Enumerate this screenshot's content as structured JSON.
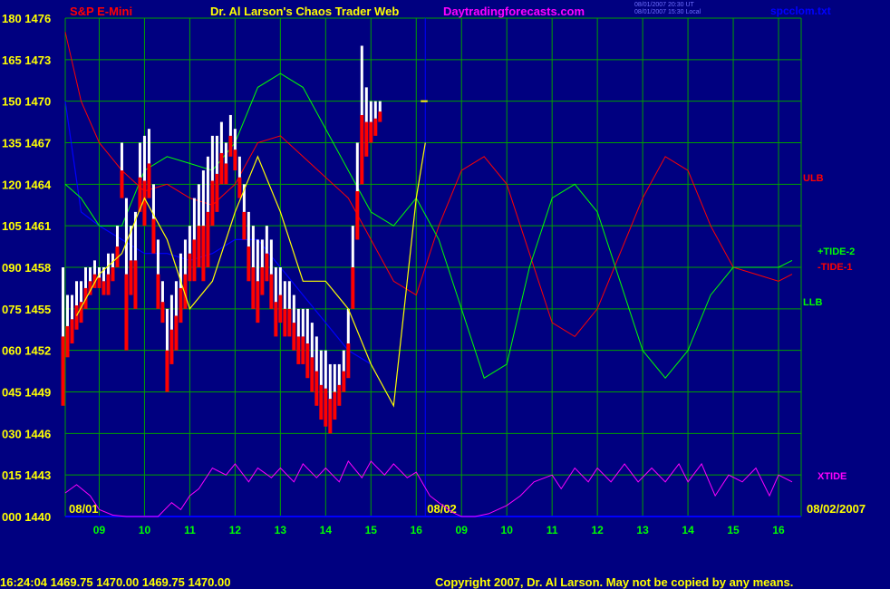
{
  "header": {
    "symbol": "S&P E-Mini",
    "title": "Dr. Al Larson's Chaos Trader Web",
    "site": "Daytradingforecasts.com",
    "time_line1": "08/01/2007 20:30 UT",
    "time_line2": "08/01/2007 15:30 Local",
    "filename": "spcclom.txt"
  },
  "footer": {
    "quote": "16:24:04  1469.75 1470.00 1469.75 1470.00",
    "copyright": "Copyright 2007, Dr. Al Larson. May not be copied by any means."
  },
  "colors": {
    "background": "#000080",
    "grid": "#00a000",
    "price_low": "#ff0000",
    "price_high": "#ffffff",
    "ulb": "#ff0000",
    "llb": "#00ff00",
    "xtide": "#ff00ff",
    "date_marker": "#0000ff"
  },
  "chart_data": {
    "type": "line",
    "title": "S&P E-Mini",
    "left_axis_ticks": [
      "180 1476",
      "165 1473",
      "150 1470",
      "135 1467",
      "120 1464",
      "105 1461",
      "090 1458",
      "075 1455",
      "060 1452",
      "045 1449",
      "030 1446",
      "015 1443",
      "000 1440"
    ],
    "ylim_price": [
      1440,
      1476
    ],
    "ylim_index": [
      0,
      180
    ],
    "x_ticks_day1": [
      "09",
      "10",
      "11",
      "12",
      "13",
      "14",
      "15",
      "16"
    ],
    "x_ticks_day2": [
      "09",
      "10",
      "11",
      "12",
      "13",
      "14",
      "15",
      "16"
    ],
    "date_labels": [
      "08/01",
      "08/02",
      "08/02/2007"
    ],
    "series_labels": [
      "ULB",
      "+TIDE-2",
      "-TIDE-1",
      "LLB",
      "XTIDE"
    ],
    "xlim_hours": [
      8.25,
      24.5
    ],
    "price_bars": {
      "x_hours": [
        8.2,
        8.3,
        8.4,
        8.5,
        8.6,
        8.7,
        8.8,
        8.9,
        9.0,
        9.1,
        9.2,
        9.3,
        9.4,
        9.5,
        9.6,
        9.7,
        9.8,
        9.9,
        10.0,
        10.1,
        10.2,
        10.3,
        10.4,
        10.5,
        10.6,
        10.7,
        10.8,
        10.9,
        11.0,
        11.1,
        11.2,
        11.3,
        11.4,
        11.5,
        11.6,
        11.7,
        11.8,
        11.9,
        12.0,
        12.1,
        12.2,
        12.3,
        12.4,
        12.5,
        12.6,
        12.7,
        12.8,
        12.9,
        13.0,
        13.1,
        13.2,
        13.3,
        13.4,
        13.5,
        13.6,
        13.7,
        13.8,
        13.9,
        14.0,
        14.1,
        14.2,
        14.3,
        14.4,
        14.5,
        14.6,
        14.7,
        14.8,
        14.9,
        15.0,
        15.1,
        15.2,
        15.3,
        15.4,
        15.5,
        15.6,
        15.7,
        15.8,
        15.9,
        16.0,
        16.1,
        16.2
      ],
      "low": [
        1448,
        1451.5,
        1452.5,
        1453.5,
        1454,
        1455,
        1456,
        1456.5,
        1456.5,
        1456,
        1456,
        1457,
        1458,
        1463,
        1452,
        1456,
        1455,
        1462,
        1461,
        1463,
        1459,
        1455,
        1454,
        1449,
        1451,
        1452,
        1454,
        1455,
        1457,
        1457,
        1458,
        1457,
        1458,
        1461,
        1462,
        1464,
        1464,
        1466,
        1465,
        1463,
        1460,
        1457,
        1455,
        1454,
        1456,
        1457,
        1455,
        1453,
        1454,
        1453,
        1453,
        1452,
        1451,
        1451,
        1450,
        1449,
        1448,
        1447,
        1446.5,
        1446,
        1447,
        1448,
        1449,
        1450,
        1455,
        1460,
        1464,
        1466,
        1467,
        1467.5,
        1468.5
      ],
      "high": [
        1458,
        1456,
        1456,
        1457,
        1457,
        1458,
        1458,
        1458.5,
        1458,
        1458,
        1459,
        1459,
        1461,
        1467,
        1463,
        1461,
        1462,
        1467,
        1467.5,
        1468,
        1464,
        1460,
        1457,
        1455,
        1456,
        1457,
        1459,
        1460,
        1461,
        1463,
        1464,
        1465,
        1466,
        1467.5,
        1467.5,
        1468.5,
        1467,
        1469,
        1468,
        1466,
        1464,
        1462,
        1461,
        1460,
        1460,
        1461,
        1460,
        1458,
        1458,
        1457,
        1457,
        1456,
        1455,
        1455,
        1455,
        1454,
        1453,
        1452,
        1452,
        1451,
        1451,
        1451,
        1452,
        1455,
        1461,
        1467,
        1474,
        1471,
        1470,
        1470,
        1470
      ],
      "close_hours": [
        16.1,
        16.25
      ],
      "last_price": 1470
    },
    "moving_average": {
      "x_hours": [
        8.5,
        9.0,
        9.5,
        10.0,
        10.5,
        11.0,
        11.5,
        12.0,
        12.5,
        13.0,
        13.5,
        14.0,
        14.5,
        15.0,
        15.5,
        16.0,
        16.2
      ],
      "values": [
        1454.5,
        1457.5,
        1459,
        1463,
        1460,
        1455,
        1457,
        1462,
        1466,
        1462,
        1457,
        1457,
        1455,
        1451,
        1448,
        1463,
        1467
      ]
    },
    "ulb": {
      "x_hours": [
        8.25,
        8.6,
        9.0,
        9.5,
        10.0,
        10.5,
        11.0,
        11.5,
        12.0,
        12.5,
        13.0,
        13.5,
        14.0,
        14.5,
        15.0,
        15.5,
        16.0,
        16.5,
        17.0,
        17.5,
        18.0,
        18.5,
        19.0,
        19.5,
        20.0,
        20.5,
        21.0,
        21.5,
        22.0,
        22.5,
        23.0,
        23.5,
        24.0,
        24.3
      ],
      "values": [
        1475,
        1470,
        1467,
        1465,
        1463.5,
        1464,
        1463,
        1462.5,
        1464,
        1467,
        1467.5,
        1466,
        1464.5,
        1463,
        1460,
        1457,
        1456,
        1461,
        1465,
        1466,
        1464,
        1459,
        1454,
        1453,
        1455,
        1459,
        1463,
        1466,
        1465,
        1461,
        1458,
        1457.5,
        1457,
        1457.5
      ]
    },
    "llb": {
      "x_hours": [
        8.25,
        8.6,
        9.0,
        9.5,
        10.0,
        10.5,
        11.0,
        11.5,
        12.0,
        12.5,
        13.0,
        13.5,
        14.0,
        14.5,
        15.0,
        15.5,
        16.0,
        16.5,
        17.0,
        17.5,
        18.0,
        18.5,
        19.0,
        19.5,
        20.0,
        20.5,
        21.0,
        21.5,
        22.0,
        22.5,
        23.0,
        23.5,
        24.0,
        24.3
      ],
      "values": [
        1464,
        1463,
        1461,
        1461,
        1465,
        1466,
        1465.5,
        1465,
        1467,
        1471,
        1472,
        1471,
        1468,
        1465,
        1462,
        1461,
        1463,
        1460,
        1455,
        1450,
        1451,
        1458,
        1463,
        1464,
        1462,
        1457,
        1452,
        1450,
        1452,
        1456,
        1458,
        1458,
        1458,
        1458.5
      ]
    },
    "blue_curve": {
      "x_hours": [
        8.25,
        8.6,
        9.0,
        9.5,
        10.0,
        10.5,
        11.0,
        11.5,
        12.0,
        12.5,
        13.0,
        13.5,
        14.0,
        14.5,
        15.0
      ],
      "values": [
        1470,
        1462,
        1461,
        1460,
        1459,
        1459,
        1458.5,
        1459,
        1460,
        1460,
        1458,
        1456,
        1454,
        1452,
        1451
      ]
    },
    "xtide": {
      "x_hours": [
        8.25,
        8.5,
        8.8,
        9.0,
        9.3,
        9.6,
        10.0,
        10.3,
        10.6,
        10.8,
        11.0,
        11.2,
        11.5,
        11.8,
        12.0,
        12.3,
        12.5,
        12.8,
        13.0,
        13.3,
        13.5,
        13.8,
        14.0,
        14.3,
        14.5,
        14.8,
        15.0,
        15.3,
        15.5,
        15.8,
        16.0,
        16.3,
        16.5,
        16.8,
        17.0,
        17.3,
        17.6,
        18.0,
        18.3,
        18.6,
        19.0,
        19.2,
        19.5,
        19.8,
        20.0,
        20.3,
        20.6,
        20.9,
        21.2,
        21.5,
        21.8,
        22.0,
        22.3,
        22.6,
        22.9,
        23.2,
        23.5,
        23.8,
        24.0,
        24.3
      ],
      "values": [
        1441.7,
        1442.3,
        1441.5,
        1440.5,
        1440.1,
        1440,
        1440,
        1440,
        1441,
        1440.5,
        1441.5,
        1442,
        1443.5,
        1443,
        1443.8,
        1442.5,
        1443.5,
        1442.8,
        1443.5,
        1442.5,
        1443.8,
        1442.8,
        1443.5,
        1442.5,
        1444,
        1442.8,
        1444,
        1443,
        1443.8,
        1442.8,
        1443.2,
        1441.5,
        1441,
        1440.3,
        1440,
        1440,
        1440.2,
        1440.8,
        1441.5,
        1442.5,
        1443,
        1442,
        1443.5,
        1442.5,
        1443.5,
        1442.5,
        1443.8,
        1442.5,
        1443.5,
        1442.5,
        1443.8,
        1442.5,
        1443.8,
        1441.5,
        1443,
        1442.5,
        1443.5,
        1441.5,
        1443,
        1442.5
      ]
    }
  }
}
